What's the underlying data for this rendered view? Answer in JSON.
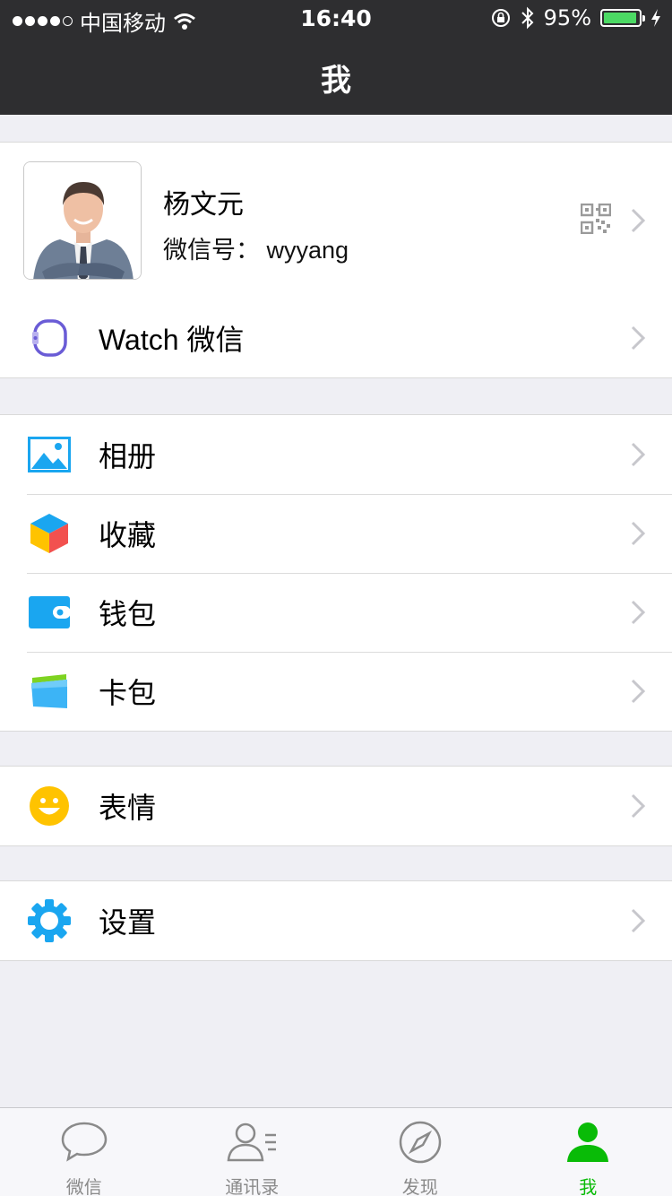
{
  "status_bar": {
    "carrier": "中国移动",
    "time": "16:40",
    "battery": "95%",
    "battery_level": 0.95
  },
  "nav": {
    "title": "我"
  },
  "profile": {
    "name": "杨文元",
    "wechat_id": "微信号： wyyang"
  },
  "watch_row": {
    "label": "Watch 微信",
    "icon": "watch-icon"
  },
  "menu_group_1": [
    {
      "label": "相册",
      "icon": "album-icon"
    },
    {
      "label": "收藏",
      "icon": "favorites-icon"
    },
    {
      "label": "钱包",
      "icon": "wallet-icon"
    },
    {
      "label": "卡包",
      "icon": "cards-icon"
    }
  ],
  "menu_group_2": [
    {
      "label": "表情",
      "icon": "emoji-icon"
    }
  ],
  "menu_group_3": [
    {
      "label": "设置",
      "icon": "settings-icon"
    }
  ],
  "tabbar": [
    {
      "label": "微信",
      "icon": "chat-icon",
      "active": false
    },
    {
      "label": "通讯录",
      "icon": "contacts-icon",
      "active": false
    },
    {
      "label": "发现",
      "icon": "compass-icon",
      "active": false
    },
    {
      "label": "我",
      "icon": "me-icon",
      "active": true
    }
  ],
  "colors": {
    "nav_bg": "#2e2e30",
    "accent_green": "#09bb07",
    "group_bg": "#efeff4",
    "battery_green": "#4cd964"
  }
}
